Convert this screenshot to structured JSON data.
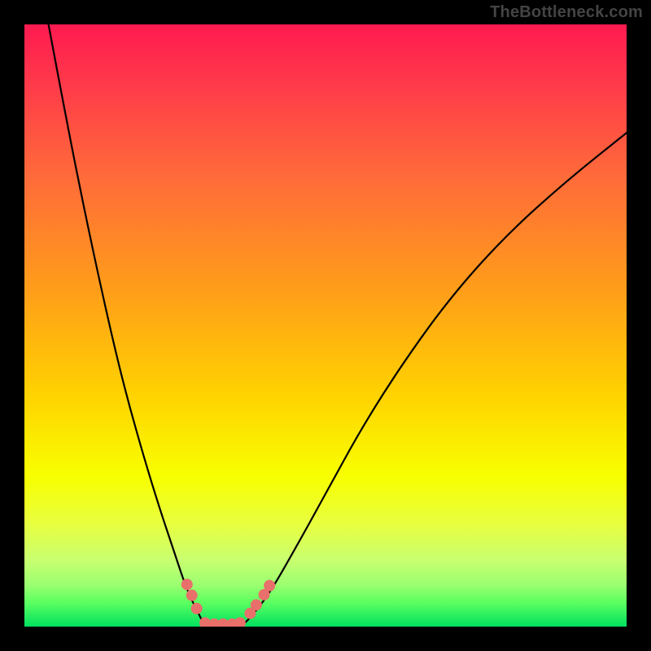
{
  "watermark": "TheBottleneck.com",
  "chart_data": {
    "type": "line",
    "title": "",
    "xlabel": "",
    "ylabel": "",
    "xlim": [
      0,
      100
    ],
    "ylim": [
      0,
      100
    ],
    "legend": false,
    "grid": false,
    "background_gradient": {
      "orientation": "vertical",
      "stops": [
        {
          "pos": 0.0,
          "color": "#ff1a50"
        },
        {
          "pos": 0.45,
          "color": "#ffa018"
        },
        {
          "pos": 0.75,
          "color": "#f8ff00"
        },
        {
          "pos": 0.93,
          "color": "#9cff70"
        },
        {
          "pos": 1.0,
          "color": "#00e060"
        }
      ]
    },
    "series": [
      {
        "name": "left-curve",
        "x": [
          4,
          7,
          10,
          13,
          16,
          19,
          22,
          25,
          27,
          29,
          30
        ],
        "y": [
          100,
          84,
          69,
          55,
          42,
          31,
          21,
          12,
          6,
          2,
          0
        ]
      },
      {
        "name": "valley-floor",
        "x": [
          30,
          32,
          34,
          36
        ],
        "y": [
          0,
          0,
          0,
          0
        ]
      },
      {
        "name": "right-curve",
        "x": [
          36,
          38,
          41,
          45,
          50,
          56,
          63,
          71,
          80,
          90,
          100
        ],
        "y": [
          0,
          2,
          6,
          13,
          22,
          33,
          44,
          55,
          65,
          74,
          82
        ]
      }
    ],
    "markers": [
      {
        "x": 27.0,
        "y": 7.0
      },
      {
        "x": 27.8,
        "y": 5.2
      },
      {
        "x": 28.6,
        "y": 3.0
      },
      {
        "x": 30.0,
        "y": 0.6
      },
      {
        "x": 31.5,
        "y": 0.4
      },
      {
        "x": 33.0,
        "y": 0.4
      },
      {
        "x": 34.5,
        "y": 0.4
      },
      {
        "x": 35.8,
        "y": 0.6
      },
      {
        "x": 37.5,
        "y": 2.2
      },
      {
        "x": 38.5,
        "y": 3.6
      },
      {
        "x": 39.8,
        "y": 5.3
      },
      {
        "x": 40.7,
        "y": 6.8
      }
    ],
    "marker_style": {
      "color": "#e96f6b",
      "radius_px": 7
    }
  }
}
